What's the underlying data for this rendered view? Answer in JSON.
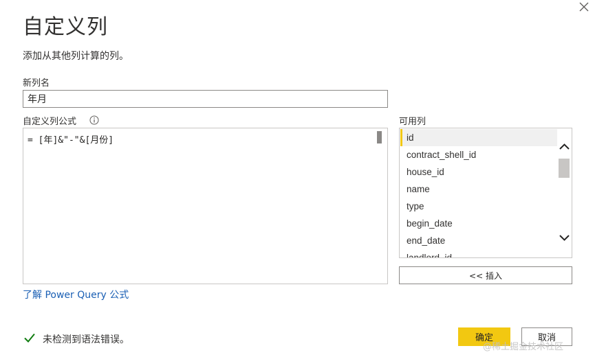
{
  "dialog": {
    "title": "自定义列",
    "subtitle": "添加从其他列计算的列。",
    "close_glyph": "✕"
  },
  "new_column": {
    "label": "新列名",
    "value": "年月"
  },
  "formula": {
    "label": "自定义列公式",
    "value": "= [年]&\"-\"&[月份]"
  },
  "available_columns": {
    "label": "可用列",
    "items": [
      "id",
      "contract_shell_id",
      "house_id",
      "name",
      "type",
      "begin_date",
      "end_date",
      "landlord_id"
    ],
    "selected": "id"
  },
  "insert_button": {
    "label": "<< 插入"
  },
  "learn_link": {
    "label": "了解 Power Query 公式"
  },
  "status": {
    "text": "未检测到语法错误。",
    "color": "#107c10"
  },
  "buttons": {
    "ok": "确定",
    "cancel": "取消"
  },
  "watermark": "@稀土掘金技术社区",
  "colors": {
    "accent": "#f2c811",
    "link": "#1a5fb4"
  }
}
